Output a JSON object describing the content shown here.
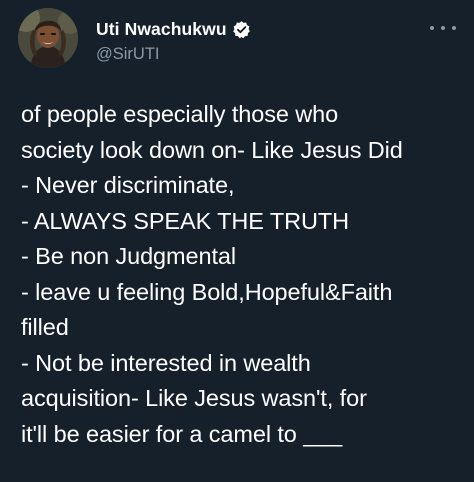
{
  "tweet": {
    "author": {
      "display_name": "Uti Nwachukwu",
      "handle": "@SirUTI",
      "verified": true
    },
    "more_icon": "more-options-icon",
    "lines": [
      "of people especially those who",
      "society look down on- Like Jesus Did",
      "- Never discriminate,",
      "- ALWAYS SPEAK THE TRUTH",
      "- Be non Judgmental",
      "- leave u feeling Bold,Hopeful&Faith",
      "filled",
      "- Not be interested in wealth",
      "acquisition- Like Jesus wasn't, for",
      "it'll be easier for a camel to ___"
    ]
  },
  "colors": {
    "background": "#15202b",
    "text": "#ffffff",
    "secondary_text": "#8b98a5",
    "verified_badge": "#ffffff"
  }
}
